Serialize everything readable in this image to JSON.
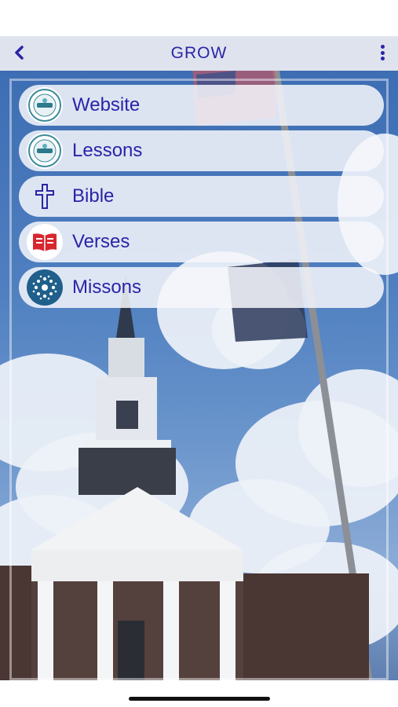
{
  "nav": {
    "title": "GROW"
  },
  "menu": {
    "items": [
      {
        "label": "Website",
        "icon": "church-logo-icon"
      },
      {
        "label": "Lessons",
        "icon": "church-logo-icon"
      },
      {
        "label": "Bible",
        "icon": "cross-icon"
      },
      {
        "label": "Verses",
        "icon": "open-book-icon"
      },
      {
        "label": "Missons",
        "icon": "globe-network-icon"
      }
    ]
  },
  "colors": {
    "accent": "#2a24a8",
    "nav_background": "#dfe3ee",
    "button_background": "#f6f7fc"
  }
}
